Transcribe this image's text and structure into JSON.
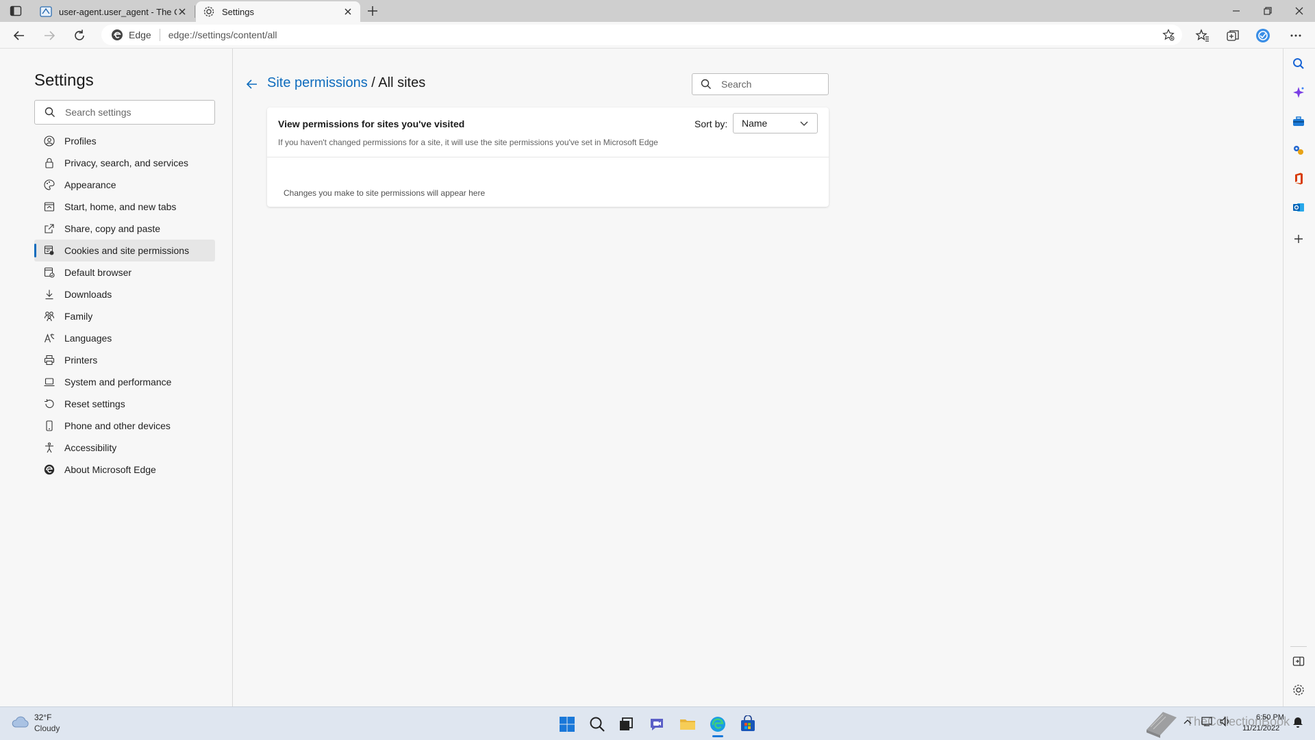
{
  "browser": {
    "tabs": [
      {
        "title": "user-agent.user_agent - The Coll",
        "active": false
      },
      {
        "title": "Settings",
        "active": true
      }
    ],
    "address": {
      "site_label": "Edge",
      "url": "edge://settings/content/all"
    }
  },
  "settings": {
    "title": "Settings",
    "search_placeholder": "Search settings",
    "nav": [
      {
        "label": "Profiles",
        "icon": "profile-icon"
      },
      {
        "label": "Privacy, search, and services",
        "icon": "lock-icon"
      },
      {
        "label": "Appearance",
        "icon": "palette-icon"
      },
      {
        "label": "Start, home, and new tabs",
        "icon": "home-icon"
      },
      {
        "label": "Share, copy and paste",
        "icon": "share-icon"
      },
      {
        "label": "Cookies and site permissions",
        "icon": "cookie-icon",
        "active": true
      },
      {
        "label": "Default browser",
        "icon": "browser-icon"
      },
      {
        "label": "Downloads",
        "icon": "download-icon"
      },
      {
        "label": "Family",
        "icon": "family-icon"
      },
      {
        "label": "Languages",
        "icon": "language-icon"
      },
      {
        "label": "Printers",
        "icon": "printer-icon"
      },
      {
        "label": "System and performance",
        "icon": "laptop-icon"
      },
      {
        "label": "Reset settings",
        "icon": "reset-icon"
      },
      {
        "label": "Phone and other devices",
        "icon": "phone-icon"
      },
      {
        "label": "Accessibility",
        "icon": "accessibility-icon"
      },
      {
        "label": "About Microsoft Edge",
        "icon": "edge-logo-icon"
      }
    ]
  },
  "main": {
    "breadcrumb_link": "Site permissions",
    "breadcrumb_sep": " / ",
    "breadcrumb_current": "All sites",
    "search_placeholder": "Search",
    "card": {
      "title": "View permissions for sites you've visited",
      "description": "If you haven't changed permissions for a site, it will use the site permissions you've set in Microsoft Edge",
      "sort_label": "Sort by:",
      "sort_value": "Name",
      "empty_message": "Changes you make to site permissions will appear here"
    }
  },
  "taskbar": {
    "weather_temp": "32°F",
    "weather_condition": "Cloudy",
    "time": "6:50 PM",
    "date": "11/21/2022",
    "watermark": "TheCollectionBook"
  },
  "colors": {
    "accent": "#0f6cbd",
    "taskbar": "#dfe6f0",
    "page_bg": "#f7f7f7"
  }
}
